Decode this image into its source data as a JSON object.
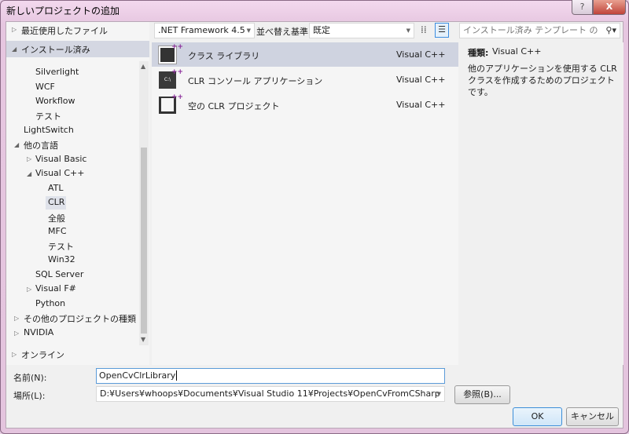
{
  "window": {
    "title": "新しいプロジェクトの追加",
    "help": "?",
    "close": "X"
  },
  "toolbar": {
    "framework": ".NET Framework 4.5",
    "sort_label": "並べ替え基準:",
    "sort_value": "既定",
    "search_placeholder": "インストール済み テンプレート の検索"
  },
  "tree": {
    "recent": "最近使用したファイル",
    "installed": "インストール済み",
    "items": [
      "Silverlight",
      "WCF",
      "Workflow",
      "テスト",
      "LightSwitch",
      "他の言語",
      "Visual Basic",
      "Visual C++",
      "ATL",
      "CLR",
      "全般",
      "MFC",
      "テスト",
      "Win32",
      "SQL Server",
      "Visual F#",
      "Python",
      "その他のプロジェクトの種類",
      "NVIDIA"
    ],
    "online": "オンライン"
  },
  "templates": [
    {
      "name": "クラス ライブラリ",
      "lang": "Visual C++",
      "icon": "class-library-icon"
    },
    {
      "name": "CLR コンソール アプリケーション",
      "lang": "Visual C++",
      "icon": "console-app-icon"
    },
    {
      "name": "空の CLR プロジェクト",
      "lang": "Visual C++",
      "icon": "empty-project-icon"
    }
  ],
  "details": {
    "type_label": "種類:",
    "type_value": "Visual C++",
    "description": "他のアプリケーションを使用する CLR クラスを作成するためのプロジェクトです。"
  },
  "form": {
    "name_label": "名前(N):",
    "name_value": "OpenCvClrLibrary",
    "location_label": "場所(L):",
    "location_value": "D:¥Users¥whoops¥Documents¥Visual Studio 11¥Projects¥OpenCvFromCSharp",
    "browse": "参照(B)...",
    "ok": "OK",
    "cancel": "キャンセル"
  }
}
